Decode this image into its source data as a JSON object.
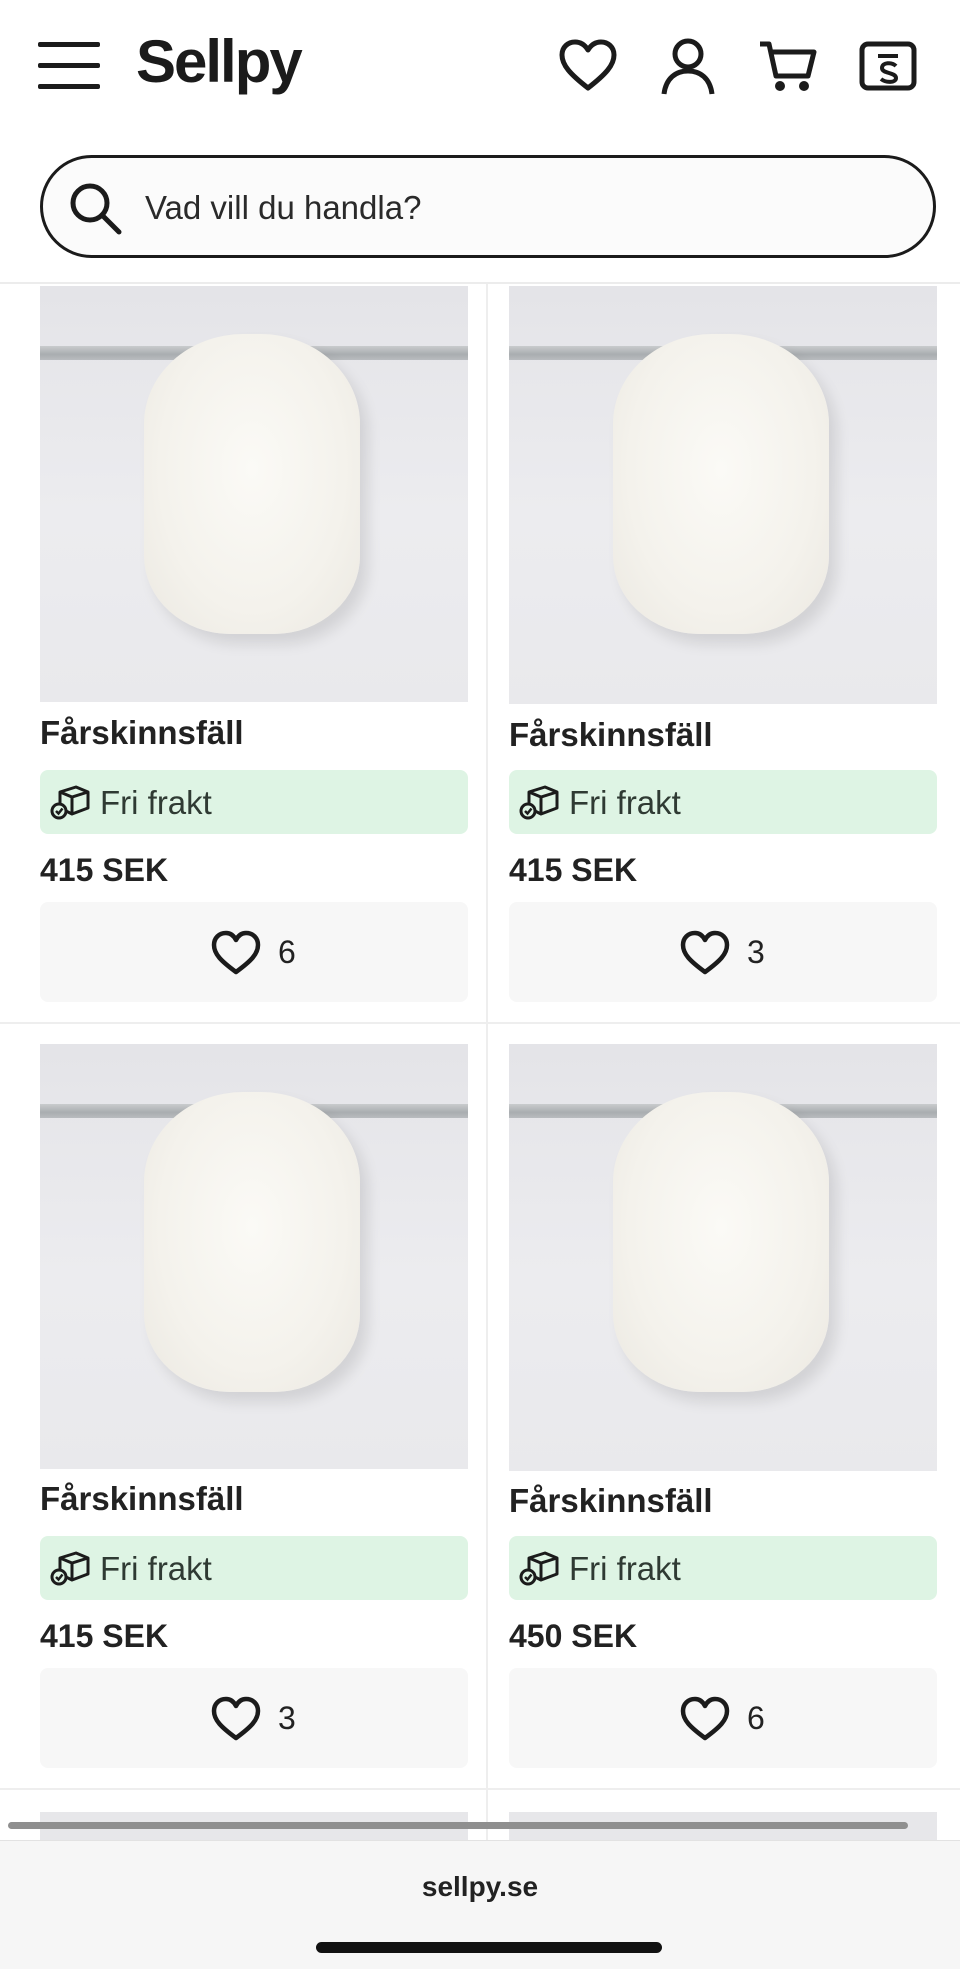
{
  "header": {
    "logo": "Sellpy",
    "icons": [
      "menu-icon",
      "heart-icon",
      "user-icon",
      "cart-icon",
      "sell-icon"
    ]
  },
  "search": {
    "placeholder": "Vad vill du handla?"
  },
  "products": [
    {
      "title": "Fårskinnsfäll",
      "shipping": "Fri frakt",
      "price": "415 SEK",
      "likes": "6"
    },
    {
      "title": "Fårskinnsfäll",
      "shipping": "Fri frakt",
      "price": "415 SEK",
      "likes": "3"
    },
    {
      "title": "Fårskinnsfäll",
      "shipping": "Fri frakt",
      "price": "415 SEK",
      "likes": "3"
    },
    {
      "title": "Fårskinnsfäll",
      "shipping": "Fri frakt",
      "price": "450 SEK",
      "likes": "6"
    }
  ],
  "browser": {
    "url": "sellpy.se"
  },
  "colors": {
    "shipping_bg": "#def4e4",
    "text": "#1b1b1b",
    "like_bg": "#f7f7f7"
  }
}
